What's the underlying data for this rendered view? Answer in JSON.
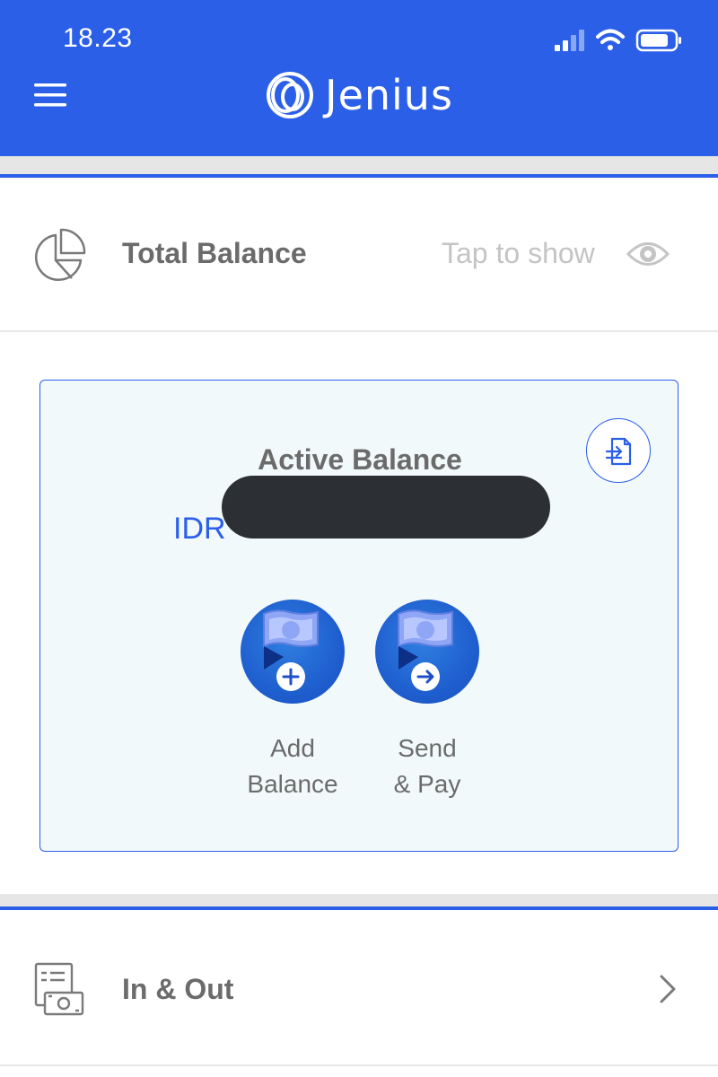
{
  "status_bar": {
    "time": "18.23",
    "icons": [
      "cellular-signal-icon",
      "wifi-icon",
      "battery-icon"
    ]
  },
  "header": {
    "menu_icon": "hamburger-menu-icon",
    "brand_name": "Jenius",
    "brand_logo_icon": "jenius-rings-logo-icon"
  },
  "total_balance": {
    "icon": "pie-chart-icon",
    "label": "Total Balance",
    "action_label": "Tap to show",
    "action_icon": "eye-icon"
  },
  "active_balance": {
    "label": "Active Balance",
    "currency": "IDR",
    "statement_icon": "export-statement-icon",
    "actions": [
      {
        "label": "Add\nBalance",
        "icon": "add-balance-icon",
        "badge_icon": "plus-icon"
      },
      {
        "label": "Send\n& Pay",
        "icon": "send-pay-icon",
        "badge_icon": "arrow-right-icon"
      }
    ]
  },
  "in_out": {
    "icon": "transactions-icon",
    "label": "In & Out",
    "chevron_icon": "chevron-right-icon"
  },
  "colors": {
    "brand_blue": "#2b5fe8",
    "card_background": "#f2f9fb",
    "text_gray": "#6b6b6b",
    "muted_gray": "#c4c4c4",
    "redaction": "#2c2f33"
  }
}
